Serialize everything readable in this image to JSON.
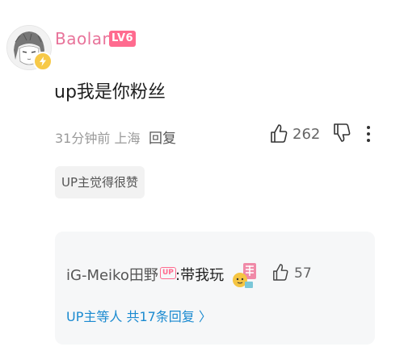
{
  "comment": {
    "username": "Baolan",
    "level": "LV6",
    "text": "up我是你粉丝",
    "time_location": "31分钟前 上海",
    "reply_label": "回复",
    "like_count": "262",
    "tag": "UP主觉得很赞",
    "icons": [
      "avatar",
      "thunder-badge-icon",
      "thumbs-up-icon",
      "thumbs-down-icon",
      "more-vertical-icon"
    ]
  },
  "reply_preview": {
    "author": "iG-Meiko田野",
    "up_badge": "UP",
    "text": ":带我玩",
    "like_count": "57",
    "more_text": "UP主等人 共17条回复 〉"
  },
  "colors": {
    "username": "#e8739a",
    "level_badge": "#ff6b8f",
    "link": "#1a8ad0",
    "reply_bg": "#f6f7f8"
  }
}
